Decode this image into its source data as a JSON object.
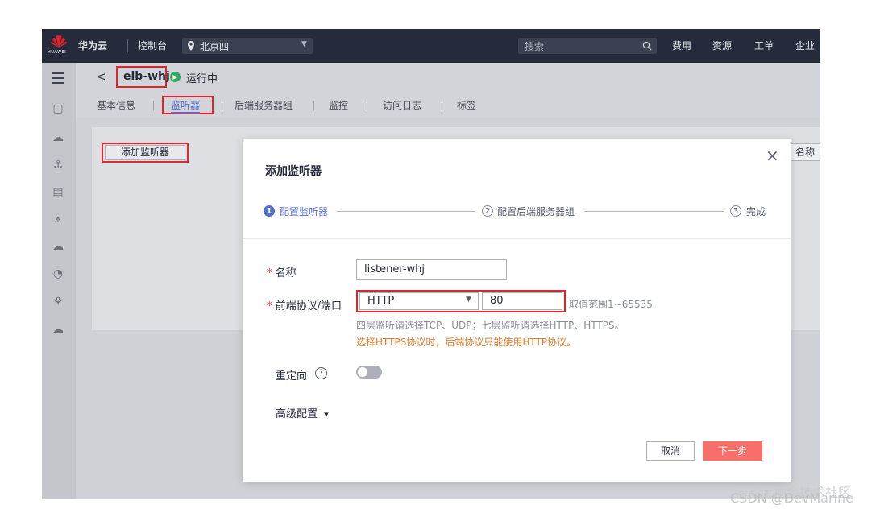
{
  "topbar": {
    "logo_text": "HUAWEI",
    "brand": "华为云",
    "console": "控制台",
    "region": "北京四",
    "search_placeholder": "搜索",
    "menu": [
      "费用",
      "资源",
      "工单",
      "企业"
    ]
  },
  "header": {
    "back": "<",
    "elb_name": "elb-whj",
    "status": "运行中",
    "status_color": "#2fa95e"
  },
  "tabs": [
    "基本信息",
    "监听器",
    "后端服务器组",
    "监控",
    "访问日志",
    "标签"
  ],
  "active_tab": "监听器",
  "panel": {
    "add_listener_button": "添加监听器",
    "column_name": "名称"
  },
  "modal": {
    "title": "添加监听器",
    "close": "×",
    "steps": [
      {
        "num": "1",
        "label": "配置监听器",
        "active": true
      },
      {
        "num": "2",
        "label": "配置后端服务器组",
        "active": false
      },
      {
        "num": "3",
        "label": "完成",
        "active": false
      }
    ],
    "form": {
      "name_label": "名称",
      "name_value": "listener-whj",
      "protocol_label": "前端协议/端口",
      "protocol_value": "HTTP",
      "port_value": "80",
      "port_range": "取值范围1~65535",
      "hint1": "四层监听请选择TCP、UDP；七层监听请选择HTTP、HTTPS。",
      "hint2": "选择HTTPS协议时，后端协议只能使用HTTP协议。",
      "redirect_label": "重定向",
      "redirect_help": "?",
      "advanced_label": "高级配置",
      "advanced_caret": "▾"
    },
    "cancel_button": "取消",
    "next_button": "下一步",
    "accent": "#526ecc",
    "primary": "#f66f6a"
  },
  "watermark": {
    "line1": "@稀土掘金技术社区",
    "line2": "CSDN @DevMarine"
  }
}
